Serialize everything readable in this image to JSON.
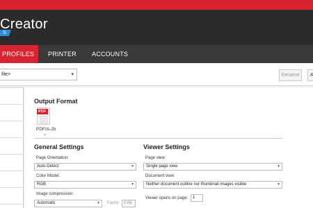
{
  "app": {
    "title": "Creator",
    "badge": "S"
  },
  "nav": {
    "profiles": "PROFILES",
    "printer": "PRINTER",
    "accounts": "ACCOUNTS"
  },
  "toolbar": {
    "profile_value": "file>",
    "rename_label": "Rename",
    "add_label": "A"
  },
  "output_format": {
    "heading": "Output Format",
    "icon_tag": "PDF",
    "format_label": "PDF/A-2b"
  },
  "general_settings": {
    "heading": "General Settings",
    "page_orientation": {
      "label": "Page Orientation:",
      "value": "Auto-Detect"
    },
    "color_model": {
      "label": "Color Model:",
      "value": "RGB"
    },
    "image_compression": {
      "label": "Image compression:",
      "value": "Automatic"
    },
    "factor": {
      "label": "Factor:",
      "value": "0.66"
    }
  },
  "viewer_settings": {
    "heading": "Viewer Settings",
    "page_view": {
      "label": "Page view:",
      "value": "Single page view"
    },
    "document_view": {
      "label": "Document view:",
      "value": "Neither document outline nor thumbnail images visible"
    },
    "viewer_opens_on_page": {
      "label": "Viewer opens on page:",
      "value": "1"
    }
  }
}
